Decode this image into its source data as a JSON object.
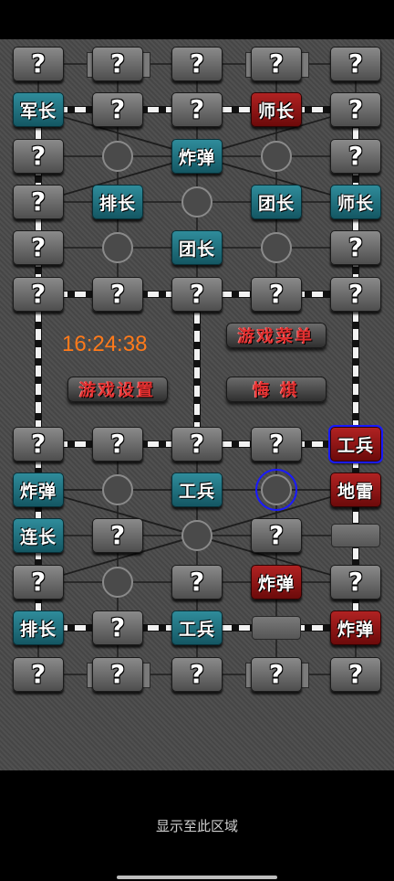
{
  "board": {
    "rows": [
      [
        "?",
        "?",
        "?",
        "?",
        "?"
      ],
      [
        "军长",
        "?",
        "?",
        "师长",
        "?"
      ],
      [
        "?",
        "",
        "炸弹",
        "",
        "?"
      ],
      [
        "?",
        "排长",
        "",
        "团长",
        "师长"
      ],
      [
        "?",
        "",
        "团长",
        "",
        "?"
      ],
      [
        "?",
        "?",
        "?",
        "?",
        "?"
      ],
      [
        "?",
        "?",
        "?",
        "?",
        "工兵"
      ],
      [
        "炸弹",
        "",
        "工兵",
        "",
        "地雷"
      ],
      [
        "连长",
        "?",
        "",
        "?",
        ""
      ],
      [
        "?",
        "",
        "?",
        "炸弹",
        "?"
      ],
      [
        "排长",
        "?",
        "工兵",
        "",
        "炸弹"
      ],
      [
        "?",
        "?",
        "?",
        "?",
        "?"
      ]
    ],
    "colors": {
      "hidden_piece": "#6e6e6e",
      "own_piece": "#1f6f7c",
      "enemy_piece": "#8a1414",
      "selection": "#1a1aff",
      "board_bg": "#4a4a4a"
    }
  },
  "clock": "16:24:38",
  "menu": {
    "game_menu": "游戏菜单",
    "game_settings": "游戏设置",
    "undo": "悔 棋"
  },
  "footer": "显示至此区域"
}
